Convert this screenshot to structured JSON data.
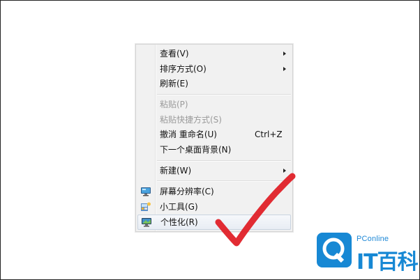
{
  "menu": {
    "items": [
      {
        "label": "查看(V)",
        "submenu": true
      },
      {
        "label": "排序方式(O)",
        "submenu": true
      },
      {
        "label": "刷新(E)"
      },
      {
        "label": "粘贴(P)",
        "disabled": true
      },
      {
        "label": "粘贴快捷方式(S)",
        "disabled": true
      },
      {
        "label": "撤消 重命名(U)",
        "shortcut": "Ctrl+Z"
      },
      {
        "label": "下一个桌面背景(N)"
      },
      {
        "label": "新建(W)",
        "submenu": true
      },
      {
        "label": "屏幕分辨率(C)",
        "icon": "screen-resolution-icon"
      },
      {
        "label": "小工具(G)",
        "icon": "gadgets-icon"
      },
      {
        "label": "个性化(R)",
        "icon": "personalize-icon",
        "highlighted": true
      }
    ]
  },
  "annotation": {
    "color": "#e01a22",
    "shape": "check-mark"
  },
  "watermark": {
    "brand_text": "PConline",
    "brand_chars": "IT百科",
    "color": "#1788d4"
  }
}
